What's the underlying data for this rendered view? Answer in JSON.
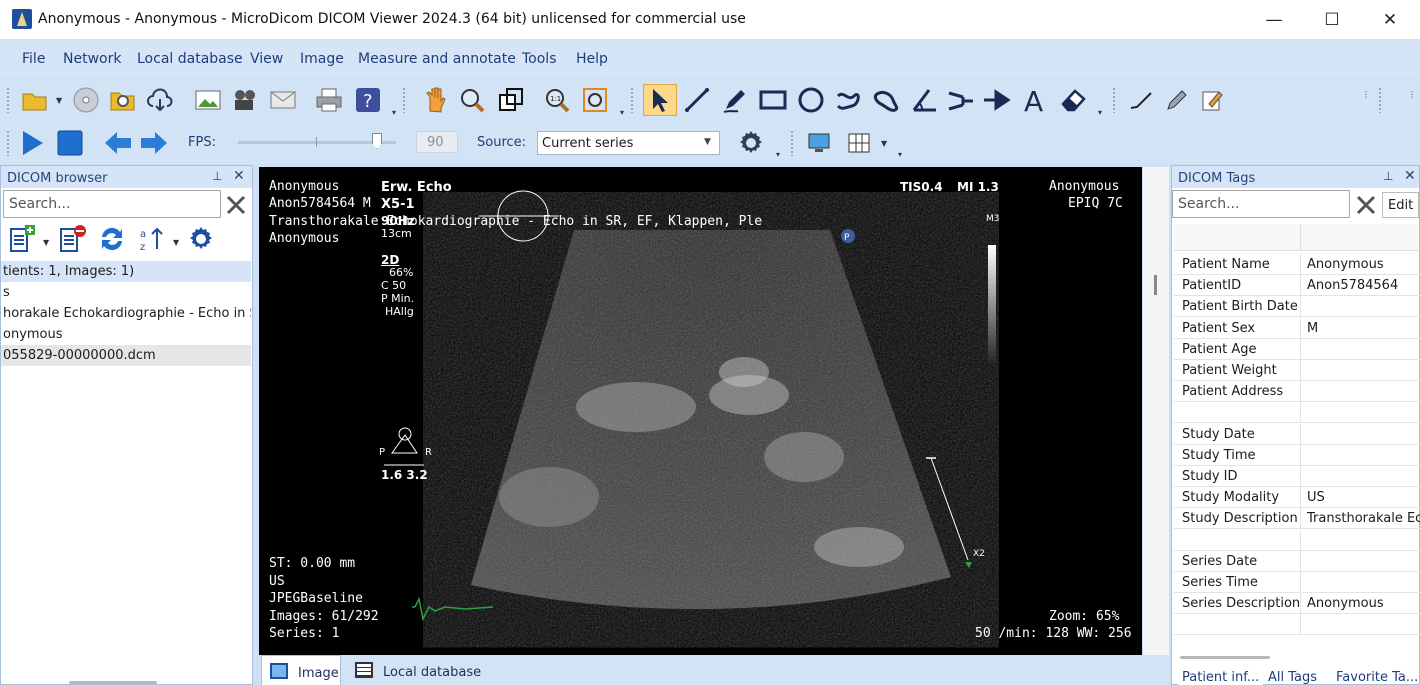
{
  "window": {
    "title": "Anonymous - Anonymous - MicroDicom DICOM Viewer 2024.3 (64 bit) unlicensed for commercial use",
    "min": "—",
    "max": "☐",
    "close": "✕"
  },
  "menu": [
    "File",
    "Network",
    "Local database",
    "View",
    "Image",
    "Measure and annotate",
    "Tools",
    "Help"
  ],
  "playback": {
    "fps_label": "FPS:",
    "fps_value": "90",
    "source_label": "Source:",
    "source_value": "Current series"
  },
  "browser": {
    "title": "DICOM browser",
    "search_placeholder": "Search...",
    "rows": [
      "tients: 1, Images: 1)",
      "s",
      "horakale Echokardiographie -  Echo in SR",
      "onymous",
      "055829-00000000.dcm"
    ]
  },
  "viewer": {
    "top_left": [
      "Anonymous",
      "Anon5784564 M",
      "Transthorakale Echokardiographie -  Echo in SR, EF, Klappen, Ple",
      "Anonymous"
    ],
    "probe": {
      "name": "Erw. Echo",
      "model": "X5-1",
      "hz": "90Hz",
      "depth": "13cm",
      "mode": "2D",
      "gain": "66%",
      "c": "C 50",
      "p": "P Min.",
      "h": "HAllg"
    },
    "orient": {
      "p": "P",
      "r": "R",
      "vals": "1.6 3.2"
    },
    "top_right": {
      "tis": "TIS0.4",
      "mi": "MI 1.3",
      "patient": "Anonymous",
      "device": "EPIQ 7C",
      "m3": "M3"
    },
    "bottom_left": [
      "ST: 0.00 mm",
      "US",
      "JPEGBaseline",
      "Images: 61/292",
      "Series: 1"
    ],
    "bottom_right": {
      "zoom": "Zoom: 65%",
      "wl": "50 /min: 128 WW: 256"
    },
    "caliper": "X2"
  },
  "tabs": {
    "image": "Image",
    "local_db": "Local database"
  },
  "tags": {
    "title": "DICOM Tags",
    "search_placeholder": "Search...",
    "edit": "Edit",
    "rows": [
      {
        "k": "Patient Name",
        "v": "Anonymous"
      },
      {
        "k": "PatientID",
        "v": "Anon5784564"
      },
      {
        "k": "Patient Birth Date",
        "v": ""
      },
      {
        "k": "Patient Sex",
        "v": "M"
      },
      {
        "k": "Patient Age",
        "v": ""
      },
      {
        "k": "Patient Weight",
        "v": ""
      },
      {
        "k": "Patient Address",
        "v": ""
      },
      {
        "k": "",
        "v": ""
      },
      {
        "k": "Study Date",
        "v": ""
      },
      {
        "k": "Study Time",
        "v": ""
      },
      {
        "k": "Study ID",
        "v": ""
      },
      {
        "k": "Study Modality",
        "v": "US"
      },
      {
        "k": "Study Description",
        "v": "Transthorakale Ec"
      },
      {
        "k": "",
        "v": ""
      },
      {
        "k": "Series Date",
        "v": ""
      },
      {
        "k": "Series Time",
        "v": ""
      },
      {
        "k": "Series Description",
        "v": "Anonymous"
      },
      {
        "k": "",
        "v": ""
      }
    ],
    "tabs": [
      "Patient inf...",
      "All Tags",
      "Favorite Ta..."
    ]
  }
}
